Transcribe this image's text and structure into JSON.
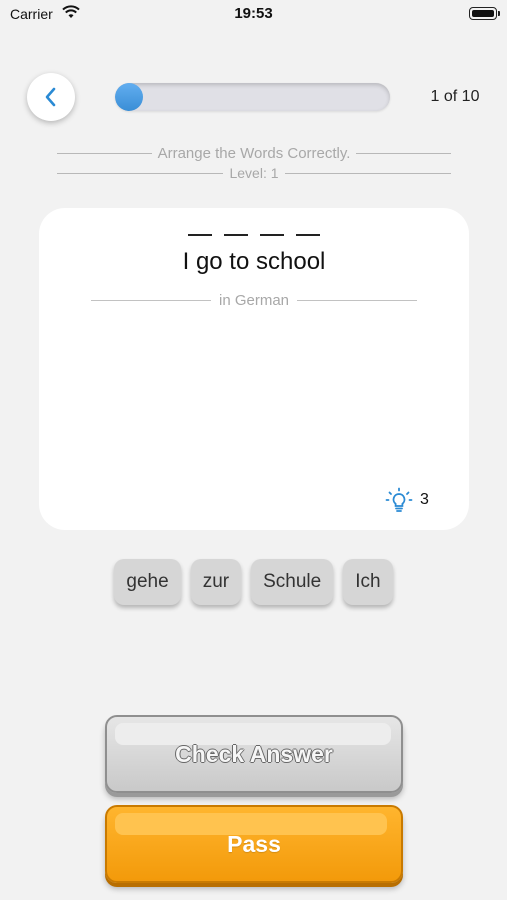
{
  "status_bar": {
    "carrier": "Carrier",
    "time": "19:53"
  },
  "progress": {
    "fraction": 0.1,
    "counter": "1 of 10"
  },
  "header": {
    "instruction": "Arrange the Words Correctly.",
    "level": "Level: 1"
  },
  "card": {
    "blank_count": 4,
    "sentence": "I go to school",
    "language_label": "in German",
    "hints_remaining": "3"
  },
  "word_bank": [
    "gehe",
    "zur",
    "Schule",
    "Ich"
  ],
  "buttons": {
    "check": "Check Answer",
    "pass": "Pass"
  },
  "colors": {
    "accent": "#3a8ed6",
    "pass": "#f39a0a",
    "hint": "#2a8ad4"
  },
  "icons": {
    "back": "chevron-left-icon",
    "hint": "lightbulb-icon",
    "wifi": "wifi-icon",
    "battery": "battery-icon"
  }
}
